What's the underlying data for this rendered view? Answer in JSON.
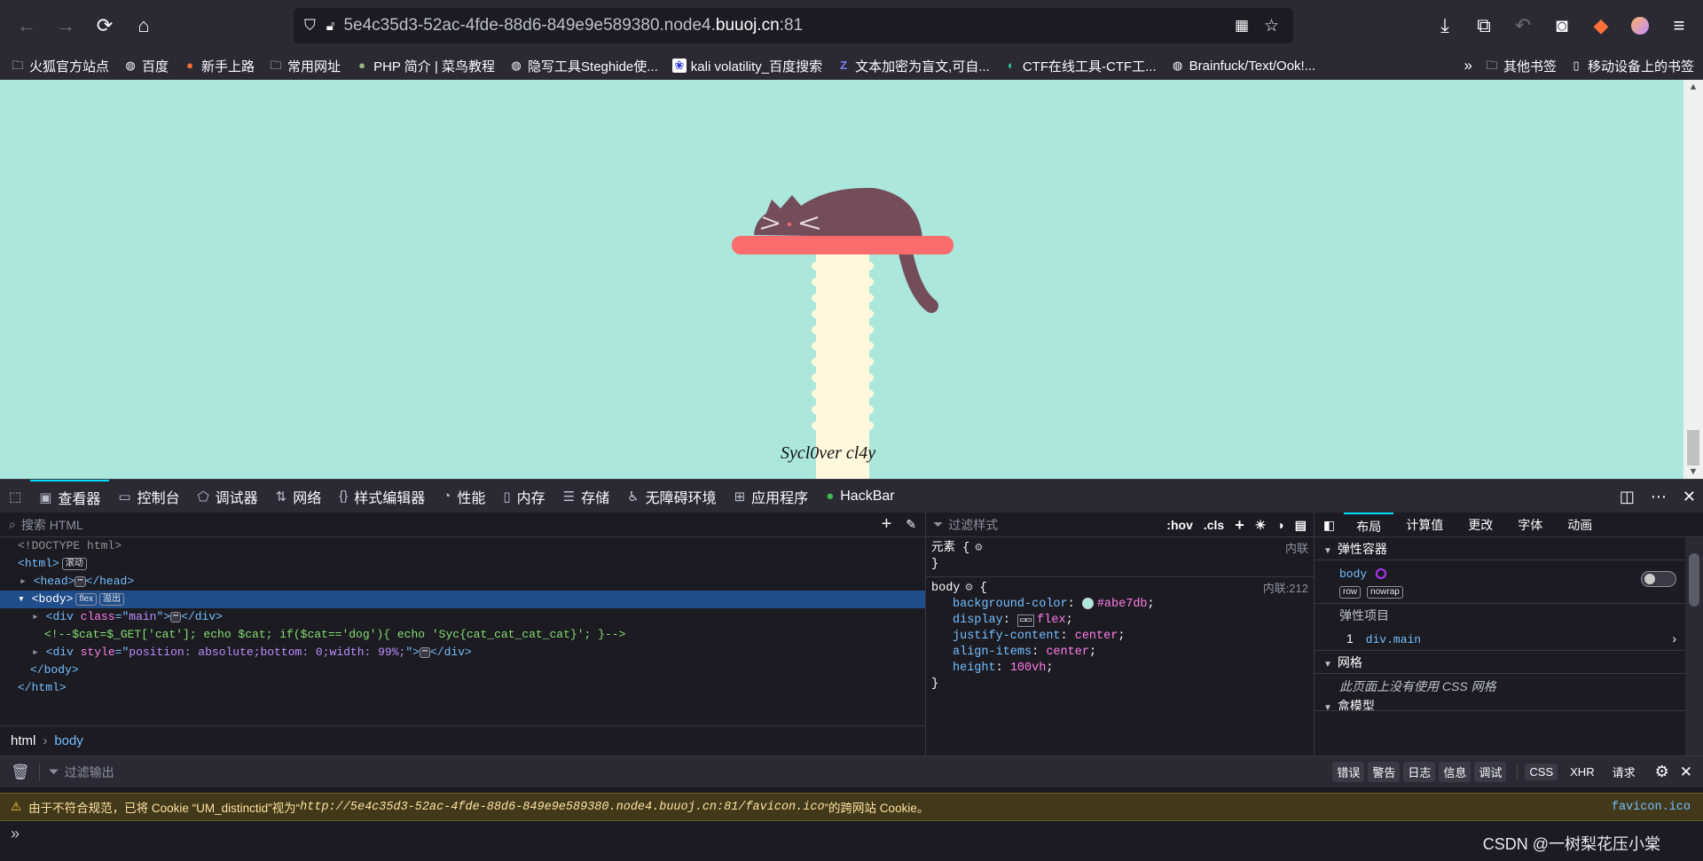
{
  "browser": {
    "url_prefix": "5e4c35d3-52ac-4fde-88d6-849e9e589380.node4.",
    "url_domain": "buuoj.cn",
    "url_suffix": ":81"
  },
  "bookmarks": {
    "items": [
      {
        "label": "火狐官方站点",
        "icon": "folder-icon"
      },
      {
        "label": "百度",
        "icon": "globe-icon"
      },
      {
        "label": "新手上路",
        "icon": "firefox-icon"
      },
      {
        "label": "常用网址",
        "icon": "folder-icon"
      },
      {
        "label": "PHP 简介 | 菜鸟教程",
        "icon": "runoob-icon"
      },
      {
        "label": "隐写工具Steghide使...",
        "icon": "globe-icon"
      },
      {
        "label": "kali volatility_百度搜索",
        "icon": "baidu-paw-icon"
      },
      {
        "label": "文本加密为盲文,可自...",
        "icon": "zi-icon"
      },
      {
        "label": "CTF在线工具-CTF工...",
        "icon": "ctf-icon"
      },
      {
        "label": "Brainfuck/Text/Ook!...",
        "icon": "globe-icon"
      }
    ],
    "other": "其他书签",
    "mobile": "移动设备上的书签"
  },
  "page": {
    "credit": "Sycl0ver cl4y",
    "colors": {
      "background": "#abe7db",
      "shelf": "#fc6c6c",
      "post": "#fff8dc",
      "cat": "#744d5b"
    }
  },
  "devtools": {
    "tabs": [
      {
        "label": "查看器",
        "icon": "inspector-icon"
      },
      {
        "label": "控制台",
        "icon": "console-icon"
      },
      {
        "label": "调试器",
        "icon": "debugger-icon"
      },
      {
        "label": "网络",
        "icon": "network-icon"
      },
      {
        "label": "样式编辑器",
        "icon": "braces-icon"
      },
      {
        "label": "性能",
        "icon": "gauge-icon"
      },
      {
        "label": "内存",
        "icon": "chip-icon"
      },
      {
        "label": "存储",
        "icon": "storage-icon"
      },
      {
        "label": "无障碍环境",
        "icon": "accessibility-icon"
      },
      {
        "label": "应用程序",
        "icon": "grid-icon"
      },
      {
        "label": "HackBar",
        "icon": "hackbar-icon"
      }
    ],
    "search_placeholder": "搜索 HTML",
    "tree": {
      "doctype": "<!DOCTYPE html>",
      "html": "html",
      "html_badge": "滚动",
      "head": "head",
      "body": "body",
      "body_badge_flex": "flex",
      "body_badge_overflow": "溢出",
      "div_attr": "class",
      "div_val": "main",
      "comment": "<!--$cat=$_GET['cat']; echo $cat; if($cat=='dog'){ echo 'Syc{cat_cat_cat_cat}'; }-->",
      "div2_attr": "style",
      "div2_val": "position: absolute;bottom: 0;width: 99%;"
    },
    "breadcrumb": [
      "html",
      "body"
    ],
    "rules": {
      "filter_placeholder": "过滤样式",
      "hov": ":hov",
      "cls": ".cls",
      "element_selector": "元素 {",
      "element_source": "内联",
      "selector": "body",
      "source": "内联:212",
      "props": [
        {
          "name": "background-color",
          "value": "#abe7db"
        },
        {
          "name": "display",
          "value": "flex"
        },
        {
          "name": "justify-content",
          "value": "center"
        },
        {
          "name": "align-items",
          "value": "center"
        },
        {
          "name": "height",
          "value": "100vh"
        }
      ]
    },
    "layout": {
      "tabs": [
        "布局",
        "计算值",
        "更改",
        "字体",
        "动画"
      ],
      "flex_container": "弹性容器",
      "flex_el": "body",
      "badge_row": "row",
      "badge_nowrap": "nowrap",
      "flex_items": "弹性项目",
      "item_index": "1",
      "item_name": "div.main",
      "grid": "网格",
      "grid_msg": "此页面上没有使用 CSS 网格",
      "box_model": "盒模型"
    }
  },
  "console": {
    "filter_placeholder": "过滤输出",
    "filters": [
      "错误",
      "警告",
      "日志",
      "信息",
      "调试"
    ],
    "types": [
      "CSS",
      "XHR",
      "请求"
    ],
    "warning_prefix": "由于不符合规范，已将 Cookie “UM_distinctid”视为“",
    "warning_url": "http://5e4c35d3-52ac-4fde-88d6-849e9e589380.node4.buuoj.cn:81/favicon.ico",
    "warning_suffix": "”的跨网站 Cookie。",
    "warning_source": "favicon.ico"
  },
  "watermark": "CSDN @一树梨花压小棠"
}
